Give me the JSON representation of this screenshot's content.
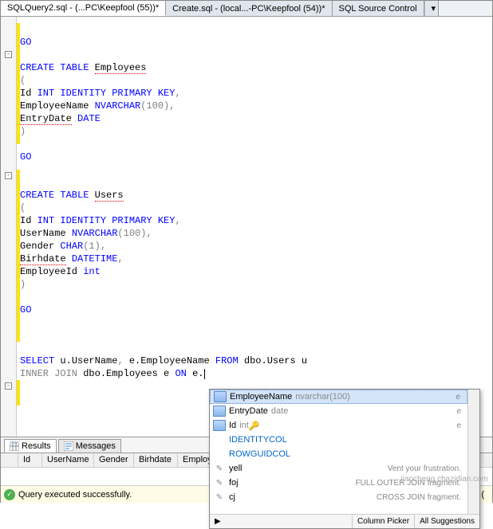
{
  "tabs": [
    {
      "label": "SQLQuery2.sql - (...PC\\Keepfool (55))*",
      "active": true
    },
    {
      "label": "Create.sql - (local...-PC\\Keepfool (54))*",
      "active": false
    },
    {
      "label": "SQL Source Control",
      "active": false
    }
  ],
  "code": {
    "go1": "GO",
    "create_emp": "CREATE TABLE",
    "emp_name": "Employees",
    "lparen": "(",
    "emp_id": {
      "name": "Id",
      "type": "INT IDENTITY PRIMARY KEY",
      "c": ","
    },
    "emp_en": {
      "name": "EmployeeName",
      "type": "NVARCHAR",
      "arg": "(100)",
      "c": ","
    },
    "emp_ed": {
      "name": "EntryDate",
      "type": "DATE"
    },
    "rparen": ")",
    "go2": "GO",
    "create_usr": "CREATE TABLE",
    "usr_name": "Users",
    "usr_id": {
      "name": "Id",
      "type": "INT IDENTITY PRIMARY KEY",
      "c": ","
    },
    "usr_un": {
      "name": "UserName",
      "type": "NVARCHAR",
      "arg": "(100)",
      "c": ","
    },
    "usr_g": {
      "name": "Gender",
      "type": "CHAR",
      "arg": "(1)",
      "c": ","
    },
    "usr_b": {
      "name": "Birhdate",
      "type": "DATETIME",
      "c": ","
    },
    "usr_e": {
      "name": "EmployeeId",
      "type": "int"
    },
    "go3": "GO",
    "sel": {
      "select": "SELECT",
      "u_un": "u.UserName",
      "c1": ",",
      "e_en": "e.EmployeeName",
      "from": "FROM",
      "tbl1": "dbo.Users u"
    },
    "join": {
      "ij": "INNER JOIN",
      "tbl": "dbo.Employees e",
      "on": "ON",
      "prefix": "e."
    }
  },
  "intellisense": {
    "items": [
      {
        "icon": "col",
        "name": "EmployeeName",
        "type": "nvarchar(100)",
        "desc": "e",
        "sel": true
      },
      {
        "icon": "col",
        "name": "EntryDate",
        "type": "date",
        "desc": "e"
      },
      {
        "icon": "col",
        "name": "Id",
        "type": "int",
        "key": true,
        "desc": "e"
      },
      {
        "icon": "blue",
        "name": "IDENTITYCOL"
      },
      {
        "icon": "blue",
        "name": "ROWGUIDCOL"
      },
      {
        "icon": "snip",
        "name": "yell",
        "desc": "Vent your frustration."
      },
      {
        "icon": "snip",
        "name": "foj",
        "desc": "FULL OUTER JOIN fragment."
      },
      {
        "icon": "snip",
        "name": "cj",
        "desc": "CROSS JOIN fragment."
      }
    ],
    "footer": {
      "arrow": "▶",
      "col_picker": "Column Picker",
      "all_sugg": "All Suggestions"
    }
  },
  "results": {
    "tab_results": "Results",
    "tab_messages": "Messages",
    "columns": [
      "Id",
      "UserName",
      "Gender",
      "Birhdate",
      "Employ"
    ]
  },
  "status": {
    "msg": "Query executed successfully.",
    "server": "(local) ("
  },
  "watermark": "jiaocheng.chazidian.com"
}
